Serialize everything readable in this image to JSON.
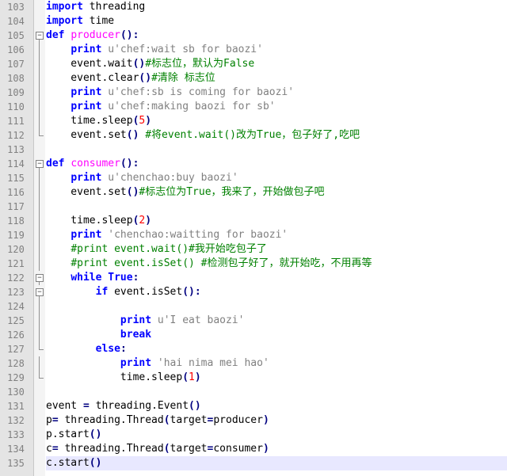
{
  "editor": {
    "current_line": 135,
    "lines": [
      {
        "n": "103",
        "fold": "none",
        "tokens": [
          [
            "kw",
            "import"
          ],
          [
            "plain",
            " threading"
          ]
        ]
      },
      {
        "n": "104",
        "fold": "none",
        "tokens": [
          [
            "kw",
            "import"
          ],
          [
            "plain",
            " time"
          ]
        ]
      },
      {
        "n": "105",
        "fold": "open",
        "tokens": [
          [
            "kw",
            "def"
          ],
          [
            "plain",
            " "
          ],
          [
            "fn",
            "producer"
          ],
          [
            "op",
            "():"
          ]
        ]
      },
      {
        "n": "106",
        "fold": "line",
        "tokens": [
          [
            "plain",
            "    "
          ],
          [
            "kw",
            "print"
          ],
          [
            "plain",
            " "
          ],
          [
            "str",
            "u'chef:wait sb for baozi'"
          ]
        ]
      },
      {
        "n": "107",
        "fold": "line",
        "tokens": [
          [
            "plain",
            "    event.wait"
          ],
          [
            "op",
            "()"
          ],
          [
            "cm",
            "#标志位，默认为False"
          ]
        ]
      },
      {
        "n": "108",
        "fold": "line",
        "tokens": [
          [
            "plain",
            "    event.clear"
          ],
          [
            "op",
            "()"
          ],
          [
            "cm",
            "#清除 标志位"
          ]
        ]
      },
      {
        "n": "109",
        "fold": "line",
        "tokens": [
          [
            "plain",
            "    "
          ],
          [
            "kw",
            "print"
          ],
          [
            "plain",
            " "
          ],
          [
            "str",
            "u'chef:sb is coming for baozi'"
          ]
        ]
      },
      {
        "n": "110",
        "fold": "line",
        "tokens": [
          [
            "plain",
            "    "
          ],
          [
            "kw",
            "print"
          ],
          [
            "plain",
            " "
          ],
          [
            "str",
            "u'chef:making baozi for sb'"
          ]
        ]
      },
      {
        "n": "111",
        "fold": "line",
        "tokens": [
          [
            "plain",
            "    time.sleep"
          ],
          [
            "op",
            "("
          ],
          [
            "num",
            "5"
          ],
          [
            "op",
            ")"
          ]
        ]
      },
      {
        "n": "112",
        "fold": "end",
        "tokens": [
          [
            "plain",
            "    event.set"
          ],
          [
            "op",
            "()"
          ],
          [
            "plain",
            " "
          ],
          [
            "cm",
            "#将event.wait()改为True，包子好了,吃吧"
          ]
        ]
      },
      {
        "n": "113",
        "fold": "none",
        "tokens": []
      },
      {
        "n": "114",
        "fold": "open",
        "tokens": [
          [
            "kw",
            "def"
          ],
          [
            "plain",
            " "
          ],
          [
            "fn",
            "consumer"
          ],
          [
            "op",
            "():"
          ]
        ]
      },
      {
        "n": "115",
        "fold": "line",
        "tokens": [
          [
            "plain",
            "    "
          ],
          [
            "kw",
            "print"
          ],
          [
            "plain",
            " "
          ],
          [
            "str",
            "u'chenchao:buy baozi'"
          ]
        ]
      },
      {
        "n": "116",
        "fold": "line",
        "tokens": [
          [
            "plain",
            "    event.set"
          ],
          [
            "op",
            "()"
          ],
          [
            "cm",
            "#标志位为True，我来了，开始做包子吧"
          ]
        ]
      },
      {
        "n": "117",
        "fold": "line",
        "tokens": []
      },
      {
        "n": "118",
        "fold": "line",
        "tokens": [
          [
            "plain",
            "    time.sleep"
          ],
          [
            "op",
            "("
          ],
          [
            "num",
            "2"
          ],
          [
            "op",
            ")"
          ]
        ]
      },
      {
        "n": "119",
        "fold": "line",
        "tokens": [
          [
            "plain",
            "    "
          ],
          [
            "kw",
            "print"
          ],
          [
            "plain",
            " "
          ],
          [
            "str",
            "'chenchao:waitting for baozi'"
          ]
        ]
      },
      {
        "n": "120",
        "fold": "line",
        "tokens": [
          [
            "plain",
            "    "
          ],
          [
            "cm",
            "#print event.wait()#我开始吃包子了"
          ]
        ]
      },
      {
        "n": "121",
        "fold": "line",
        "tokens": [
          [
            "plain",
            "    "
          ],
          [
            "cm",
            "#print event.isSet() #检测包子好了，就开始吃，不用再等"
          ]
        ]
      },
      {
        "n": "122",
        "fold": "open",
        "tokens": [
          [
            "plain",
            "    "
          ],
          [
            "kw",
            "while"
          ],
          [
            "plain",
            " "
          ],
          [
            "kw",
            "True"
          ],
          [
            "op",
            ":"
          ]
        ]
      },
      {
        "n": "123",
        "fold": "open",
        "tokens": [
          [
            "plain",
            "        "
          ],
          [
            "kw",
            "if"
          ],
          [
            "plain",
            " event.isSet"
          ],
          [
            "op",
            "():"
          ]
        ]
      },
      {
        "n": "124",
        "fold": "line",
        "tokens": []
      },
      {
        "n": "125",
        "fold": "line",
        "tokens": [
          [
            "plain",
            "            "
          ],
          [
            "kw",
            "print"
          ],
          [
            "plain",
            " "
          ],
          [
            "str",
            "u'I eat baozi'"
          ]
        ]
      },
      {
        "n": "126",
        "fold": "line",
        "tokens": [
          [
            "plain",
            "            "
          ],
          [
            "kw",
            "break"
          ]
        ]
      },
      {
        "n": "127",
        "fold": "end",
        "tokens": [
          [
            "plain",
            "        "
          ],
          [
            "kw",
            "else"
          ],
          [
            "op",
            ":"
          ]
        ]
      },
      {
        "n": "128",
        "fold": "line",
        "tokens": [
          [
            "plain",
            "            "
          ],
          [
            "kw",
            "print"
          ],
          [
            "plain",
            " "
          ],
          [
            "str",
            "'hai nima mei hao'"
          ]
        ]
      },
      {
        "n": "129",
        "fold": "end",
        "tokens": [
          [
            "plain",
            "            time.sleep"
          ],
          [
            "op",
            "("
          ],
          [
            "num",
            "1"
          ],
          [
            "op",
            ")"
          ]
        ]
      },
      {
        "n": "130",
        "fold": "none",
        "tokens": []
      },
      {
        "n": "131",
        "fold": "none",
        "tokens": [
          [
            "plain",
            "event "
          ],
          [
            "op",
            "="
          ],
          [
            "plain",
            " threading.Event"
          ],
          [
            "op",
            "()"
          ]
        ]
      },
      {
        "n": "132",
        "fold": "none",
        "tokens": [
          [
            "plain",
            "p"
          ],
          [
            "op",
            "="
          ],
          [
            "plain",
            " threading.Thread"
          ],
          [
            "op",
            "("
          ],
          [
            "plain",
            "target"
          ],
          [
            "op",
            "="
          ],
          [
            "plain",
            "producer"
          ],
          [
            "op",
            ")"
          ]
        ]
      },
      {
        "n": "133",
        "fold": "none",
        "tokens": [
          [
            "plain",
            "p.start"
          ],
          [
            "op",
            "()"
          ]
        ]
      },
      {
        "n": "134",
        "fold": "none",
        "tokens": [
          [
            "plain",
            "c"
          ],
          [
            "op",
            "="
          ],
          [
            "plain",
            " threading.Thread"
          ],
          [
            "op",
            "("
          ],
          [
            "plain",
            "target"
          ],
          [
            "op",
            "="
          ],
          [
            "plain",
            "consumer"
          ],
          [
            "op",
            ")"
          ]
        ]
      },
      {
        "n": "135",
        "fold": "none",
        "tokens": [
          [
            "plain",
            "c.start"
          ],
          [
            "op",
            "()"
          ]
        ]
      }
    ]
  }
}
